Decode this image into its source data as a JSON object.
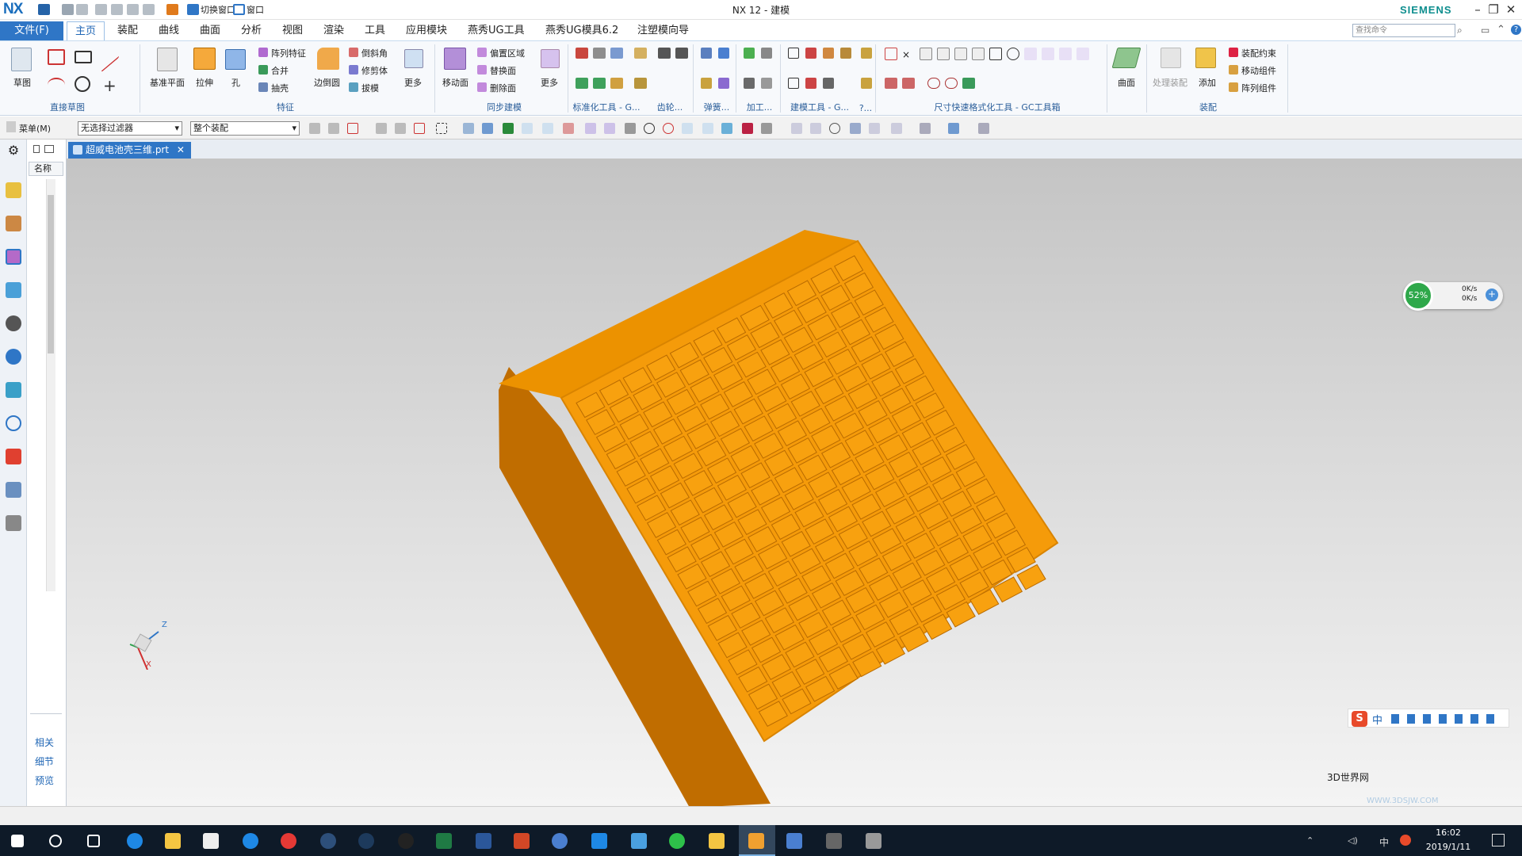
{
  "app": {
    "logo": "NX",
    "title": "NX 12 - 建模",
    "brand": "SIEMENS",
    "quick_access": {
      "switch_window": "切换窗口",
      "window": "窗口"
    },
    "window_controls": {
      "minimize": "–",
      "restore": "❐",
      "close": "✕"
    }
  },
  "menu_tabs": [
    {
      "label": "文件(F)"
    },
    {
      "label": "主页"
    },
    {
      "label": "装配"
    },
    {
      "label": "曲线"
    },
    {
      "label": "曲面"
    },
    {
      "label": "分析"
    },
    {
      "label": "视图"
    },
    {
      "label": "渲染"
    },
    {
      "label": "工具"
    },
    {
      "label": "应用模块"
    },
    {
      "label": "燕秀UG工具"
    },
    {
      "label": "燕秀UG模具6.2"
    },
    {
      "label": "注塑模向导"
    }
  ],
  "search": {
    "placeholder": "查找命令"
  },
  "ribbon": {
    "sketch": {
      "label": "草图",
      "group": "直接草图"
    },
    "feature": {
      "datum": "基准平面",
      "extrude": "拉伸",
      "hole": "孔",
      "pattern": "阵列特征",
      "unite": "合并",
      "shell": "抽壳",
      "edge_blend": "边倒圆",
      "chamfer": "倒斜角",
      "trim_body": "修剪体",
      "draft": "拔模",
      "more": "更多",
      "group": "特征"
    },
    "sync": {
      "move_face": "移动面",
      "offset_region": "偏置区域",
      "replace_face": "替换面",
      "delete_face": "删除面",
      "more": "更多",
      "group": "同步建模"
    },
    "groups_right": {
      "standard": "标准化工具 - G...",
      "gear": "齿轮...",
      "spring": "弹簧...",
      "machining": "加工...",
      "modeling_tools": "建模工具 - G...",
      "misc": "?...",
      "dimension": "尺寸快速格式化工具 - GC工具箱",
      "surface": "曲面",
      "assembly": "装配"
    },
    "assembly": {
      "process": "处理装配",
      "add": "添加",
      "constraint": "装配约束",
      "move_component": "移动组件",
      "pattern_component": "阵列组件",
      "surface_btn": "曲面"
    }
  },
  "filterbar": {
    "menu": "菜单(M)",
    "filter": "无选择过滤器",
    "scope": "整个装配"
  },
  "nav_panel": {
    "header": "名称",
    "related": "相关",
    "detail": "细节",
    "preview": "预览"
  },
  "document": {
    "tab": "超威电池壳三维.prt"
  },
  "triad": {
    "z": "Z",
    "x": "X"
  },
  "network": {
    "percent": "52%",
    "up": "0K/s",
    "down": "0K/s"
  },
  "ime": {
    "label": "中"
  },
  "watermark": {
    "text": "3D世界网",
    "url": "WWW.3DSJW.COM"
  },
  "taskbar": {
    "time": "16:02",
    "date": "2019/1/11",
    "lang": "中"
  },
  "colors": {
    "accent": "#2f76c6",
    "part": "#f59b0a",
    "part_dark": "#c06d00",
    "taskbar": "#0e1a28"
  }
}
